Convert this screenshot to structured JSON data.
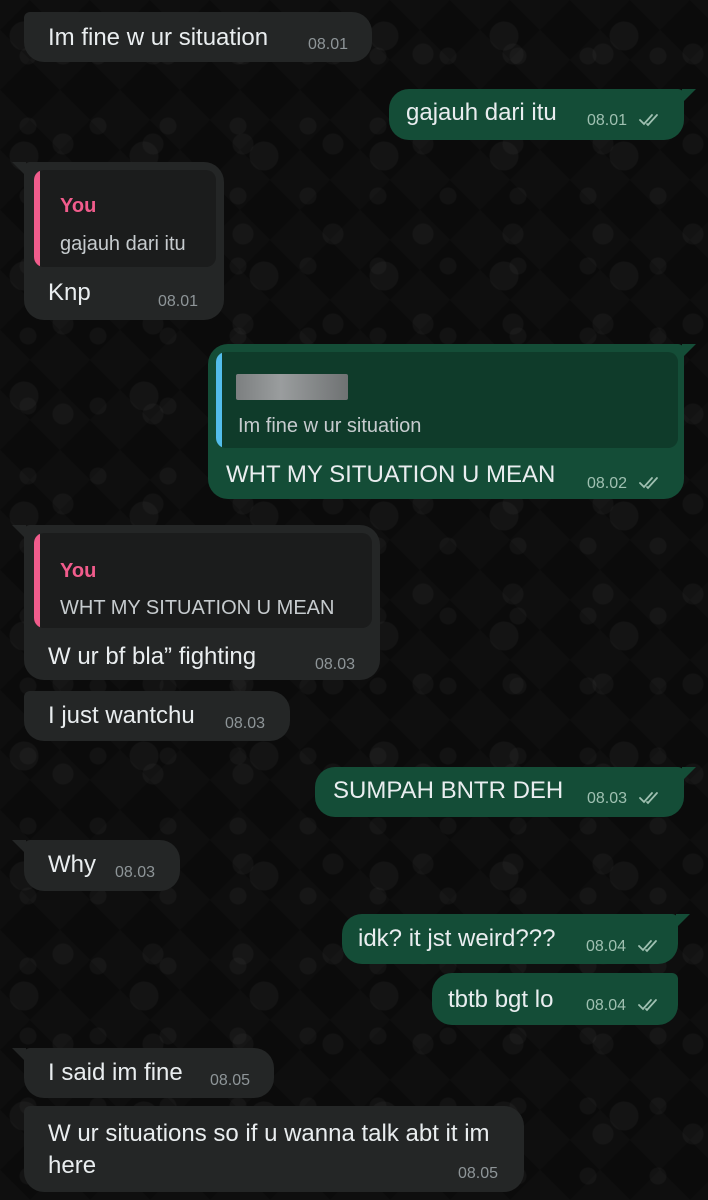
{
  "colors": {
    "background": "#0b0b0b",
    "incoming_bubble": "#242626",
    "outgoing_bubble": "#144d37",
    "quote_you_accent": "#f15c8c",
    "quote_contact_accent": "#53bdeb",
    "read_ticks": "#9fc0b1"
  },
  "messages": [
    {
      "direction": "incoming",
      "text": "Im fine w ur situation",
      "time": "08.01"
    },
    {
      "direction": "outgoing",
      "text": "gajauh dari itu",
      "time": "08.01",
      "status_icon": "double-check-icon"
    },
    {
      "direction": "incoming",
      "quote": {
        "author": "You",
        "text": "gajauh dari itu"
      },
      "text": "Knp",
      "time": "08.01"
    },
    {
      "direction": "outgoing",
      "quote": {
        "author": "",
        "text": "Im fine w ur situation"
      },
      "text": "WHT MY SITUATION U MEAN",
      "time": "08.02",
      "status_icon": "double-check-icon"
    },
    {
      "direction": "incoming",
      "quote": {
        "author": "You",
        "text": "WHT MY SITUATION U MEAN"
      },
      "text": "W ur bf bla” fighting",
      "time": "08.03"
    },
    {
      "direction": "incoming",
      "text": "I just wantchu",
      "time": "08.03"
    },
    {
      "direction": "outgoing",
      "text": "SUMPAH BNTR DEH",
      "time": "08.03",
      "status_icon": "double-check-icon"
    },
    {
      "direction": "incoming",
      "text": "Why",
      "time": "08.03"
    },
    {
      "direction": "outgoing",
      "text": "idk? it jst weird???",
      "time": "08.04",
      "status_icon": "double-check-icon"
    },
    {
      "direction": "outgoing",
      "text": "tbtb bgt lo",
      "time": "08.04",
      "status_icon": "double-check-icon"
    },
    {
      "direction": "incoming",
      "text": "I said im fine",
      "time": "08.05"
    },
    {
      "direction": "incoming",
      "text": "W ur situations so if u wanna talk abt it im here",
      "time": "08.05"
    }
  ]
}
